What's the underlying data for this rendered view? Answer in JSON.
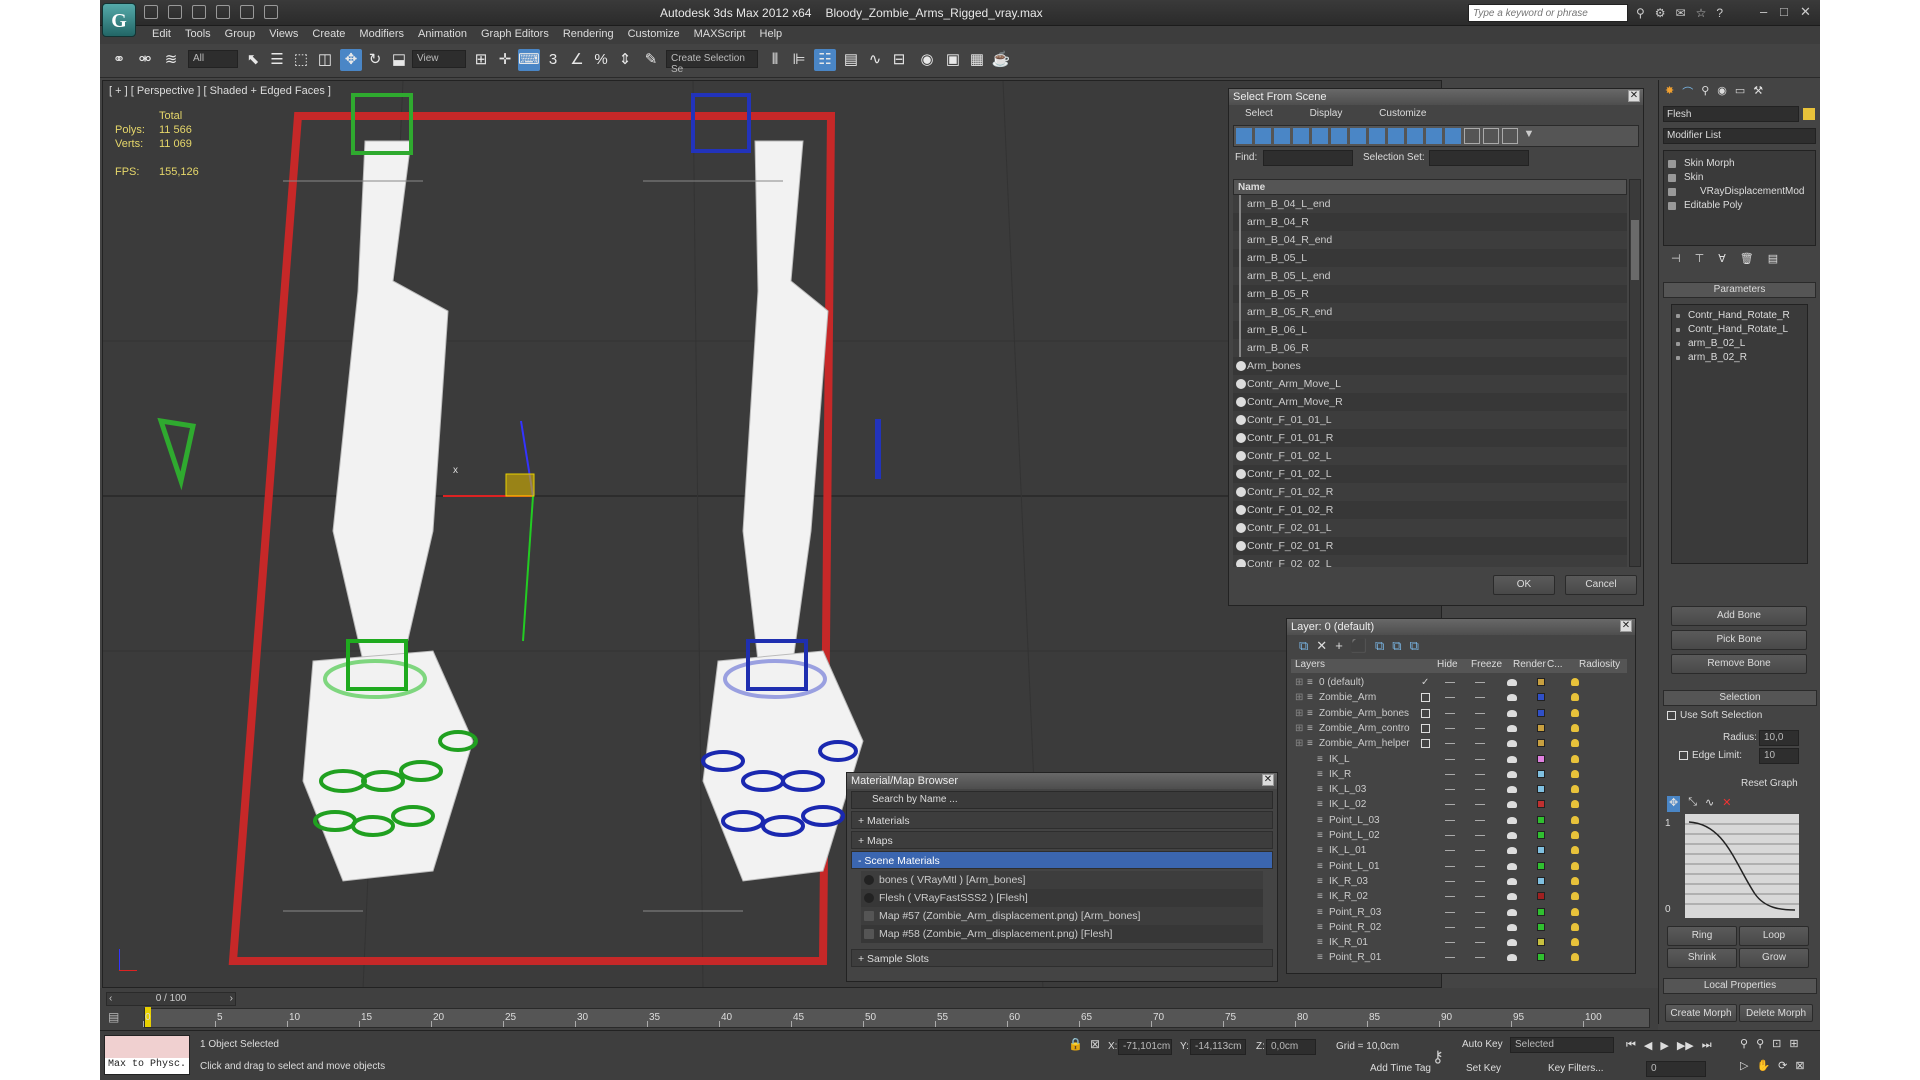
{
  "app": {
    "title": "Autodesk 3ds Max  2012 x64",
    "file": "Bloody_Zombie_Arms_Rigged_vray.max",
    "search_placeholder": "Type a keyword or phrase",
    "logo_glyph": "G"
  },
  "menu": [
    "Edit",
    "Tools",
    "Group",
    "Views",
    "Create",
    "Modifiers",
    "Animation",
    "Graph Editors",
    "Rendering",
    "Customize",
    "MAXScript",
    "Help"
  ],
  "toolbar": {
    "filter": "All",
    "refcoord": "View",
    "named_selection": "Create Selection Se",
    "snap_label": "3"
  },
  "viewport": {
    "label": "[ + ] [ Perspective ] [ Shaded + Edged Faces ]",
    "stats": {
      "total_label": "Total",
      "polys_label": "Polys:",
      "polys": "11 566",
      "verts_label": "Verts:",
      "verts": "11 069",
      "fps_label": "FPS:",
      "fps": "155,126"
    },
    "axis_x": "x"
  },
  "select_scene": {
    "title": "Select From Scene",
    "tabs": [
      "Select",
      "Display",
      "Customize"
    ],
    "find_label": "Find:",
    "selset_label": "Selection Set:",
    "col_name": "Name",
    "items": [
      "arm_B_04_L_end",
      "arm_B_04_R",
      "arm_B_04_R_end",
      "arm_B_05_L",
      "arm_B_05_L_end",
      "arm_B_05_R",
      "arm_B_05_R_end",
      "arm_B_06_L",
      "arm_B_06_R",
      "Arm_bones",
      "Contr_Arm_Move_L",
      "Contr_Arm_Move_R",
      "Contr_F_01_01_L",
      "Contr_F_01_01_R",
      "Contr_F_01_02_L",
      "Contr_F_01_02_L",
      "Contr_F_01_02_R",
      "Contr_F_01_02_R",
      "Contr_F_02_01_L",
      "Contr_F_02_01_R",
      "Contr_F_02_02_L"
    ],
    "ok": "OK",
    "cancel": "Cancel"
  },
  "layers": {
    "title": "Layer: 0 (default)",
    "cols": [
      "Layers",
      "Hide",
      "Freeze",
      "Render",
      "C...",
      "Radiosity"
    ],
    "rows": [
      {
        "name": "0 (default)",
        "color": "#c8a040"
      },
      {
        "name": "Zombie_Arm",
        "color": "#3050c8"
      },
      {
        "name": "Zombie_Arm_bones",
        "color": "#3050c8"
      },
      {
        "name": "Zombie_Arm_contro",
        "color": "#c8a040"
      },
      {
        "name": "Zombie_Arm_helper",
        "color": "#c8a040"
      },
      {
        "name": "IK_L",
        "color": "#e080e0"
      },
      {
        "name": "IK_R",
        "color": "#80c0e0"
      },
      {
        "name": "IK_L_03",
        "color": "#80c0e0"
      },
      {
        "name": "IK_L_02",
        "color": "#c03030"
      },
      {
        "name": "Point_L_03",
        "color": "#30c030"
      },
      {
        "name": "Point_L_02",
        "color": "#30c030"
      },
      {
        "name": "IK_L_01",
        "color": "#80c0e0"
      },
      {
        "name": "Point_L_01",
        "color": "#30c030"
      },
      {
        "name": "IK_R_03",
        "color": "#80c0e0"
      },
      {
        "name": "IK_R_02",
        "color": "#a02020"
      },
      {
        "name": "Point_R_03",
        "color": "#30c030"
      },
      {
        "name": "Point_R_02",
        "color": "#30c030"
      },
      {
        "name": "IK_R_01",
        "color": "#c8c040"
      },
      {
        "name": "Point_R_01",
        "color": "#30c030"
      }
    ]
  },
  "material_browser": {
    "title": "Material/Map Browser",
    "search": "Search by Name ...",
    "materials": "+ Materials",
    "maps": "+ Maps",
    "scene_materials": "- Scene Materials",
    "items": [
      "bones  ( VRayMtl ) [Arm_bones]",
      "Flesh  ( VRayFastSSS2 ) [Flesh]",
      "Map #57 (Zombie_Arm_displacement.png) [Arm_bones]",
      "Map #58 (Zombie_Arm_displacement.png) [Flesh]"
    ],
    "sample_slots": "+ Sample Slots"
  },
  "command_panel": {
    "object_name": "Flesh",
    "modifier_list": "Modifier List",
    "stack": [
      "Skin Morph",
      "Skin",
      "VRayDisplacementMod",
      "Editable Poly"
    ],
    "parameters": "Parameters",
    "bones": [
      "Contr_Hand_Rotate_R",
      "Contr_Hand_Rotate_L",
      "arm_B_02_L",
      "arm_B_02_R"
    ],
    "add_bone": "Add Bone",
    "pick_bone": "Pick Bone",
    "remove_bone": "Remove Bone",
    "selection": "Selection",
    "use_soft": "Use Soft Selection",
    "radius_label": "Radius:",
    "radius": "10,0",
    "edge_label": "Edge Limit:",
    "edge": "10",
    "reset_graph": "Reset Graph",
    "graph_1": "1",
    "graph_0": "0",
    "ring": "Ring",
    "loop": "Loop",
    "shrink": "Shrink",
    "grow": "Grow",
    "local_props": "Local Properties",
    "create_morph": "Create Morph",
    "delete_morph": "Delete Morph"
  },
  "timeline": {
    "frame": "0 / 100",
    "ticks": [
      "0",
      "5",
      "10",
      "15",
      "20",
      "25",
      "30",
      "35",
      "40",
      "45",
      "50",
      "55",
      "60",
      "65",
      "70",
      "75",
      "80",
      "85",
      "90",
      "95",
      "100"
    ]
  },
  "status": {
    "maxscript": "Max to Physc.",
    "selected": "1 Object Selected",
    "prompt": "Click and drag to select and move objects",
    "x_label": "X:",
    "x": "-71,101cm",
    "y_label": "Y:",
    "y": "-14,113cm",
    "z_label": "Z:",
    "z": "0,0cm",
    "grid": "Grid = 10,0cm",
    "autokey": "Auto Key",
    "setkey": "Set Key",
    "selected_mode": "Selected",
    "key_filters": "Key Filters...",
    "add_time_tag": "Add Time Tag",
    "frame_field": "0"
  }
}
